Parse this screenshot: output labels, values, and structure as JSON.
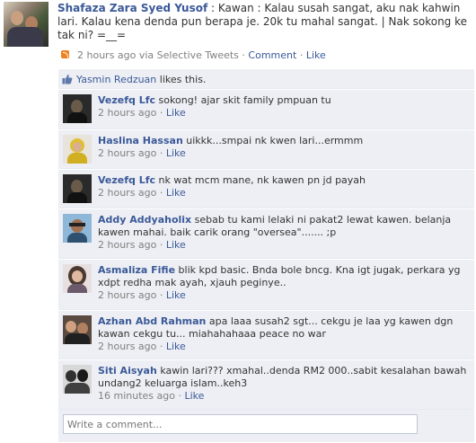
{
  "post": {
    "author": "Shafaza Zara Syed Yusof",
    "message": ": Kawan : Kalau susah sangat, aku nak kahwin lari. Kalau kena denda pun berapa je. 20k tu mahal sangat. | Nak sokong ke tak ni? =__=",
    "time": "2 hours ago via Selective Tweets",
    "separator": " · ",
    "comment_label": "Comment",
    "like_label": "Like"
  },
  "likes": {
    "liker": "Yasmin Redzuan",
    "suffix": " likes this."
  },
  "comments": [
    {
      "name": "Vezefq Lfc",
      "text": "sokong! ajar skit family pmpuan tu",
      "time": "2 hours ago",
      "like": "Like"
    },
    {
      "name": "Haslina Hassan",
      "text": "uikkk...smpai nk kwen lari...ermmm",
      "time": "2 hours ago",
      "like": "Like"
    },
    {
      "name": "Vezefq Lfc",
      "text": "nk wat mcm mane, nk kawen pn jd payah",
      "time": "2 hours ago",
      "like": "Like"
    },
    {
      "name": "Addy Addyaholix",
      "text": "sebab tu kami lelaki ni pakat2 lewat kawen. belanja kawen mahai. baik carik orang \"oversea\"....... ;p",
      "time": "2 hours ago",
      "like": "Like"
    },
    {
      "name": "Asmaliza Fifie",
      "text": "blik kpd basic. Bnda bole bncg. Kna igt jugak, perkara yg xdpt redha mak ayah, xjauh peginye..",
      "time": "2 hours ago",
      "like": "Like"
    },
    {
      "name": "Azhan Abd Rahman",
      "text": "apa laaa susah2 sgt... cekgu je laa yg kawen dgn kawan cekgu tu... miahahahaaa peace no war",
      "time": "2 hours ago",
      "like": "Like"
    },
    {
      "name": "Siti Aisyah",
      "text": "kawin lari??? xmahal..denda RM2 000..sabit kesalahan bawah undang2 keluarga islam..keh3",
      "time": "16 minutes ago",
      "like": "Like"
    }
  ],
  "comment_box": {
    "placeholder": "Write a comment..."
  },
  "colors": {
    "link": "#3b5998",
    "feedback_bg": "#edeff4",
    "meta": "#808080"
  }
}
